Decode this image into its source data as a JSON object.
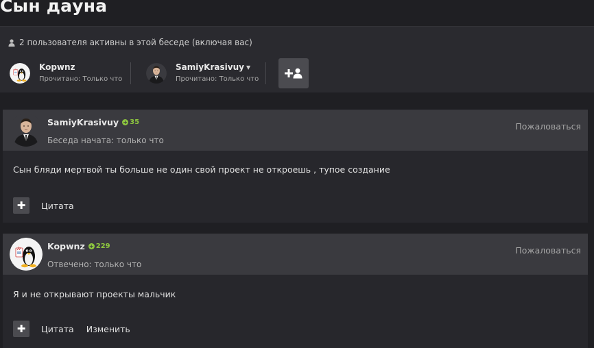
{
  "page": {
    "title": "Сын дауна"
  },
  "conversation": {
    "active_text": "2 пользователя активны в этой беседе (включая вас)",
    "participants": [
      {
        "name": "Kopwnz",
        "status": "Прочитано: Только что",
        "avatar": "tux-java-avatar"
      },
      {
        "name": "SamiyKrasivuy",
        "status": "Прочитано: Только что",
        "avatar": "suit-man-avatar",
        "has_dropdown": true
      }
    ],
    "add_participant_icon": "user-plus-icon"
  },
  "messages": [
    {
      "author": "SamiyKrasivuy",
      "reputation": "35",
      "meta": "Беседа начата: только что",
      "report_label": "Пожаловаться",
      "body": "Сын бляди мертвой ты больше не один свой проект не откроешь , тупое создание",
      "actions": [
        "Цитата"
      ],
      "avatar": "suit-man-avatar"
    },
    {
      "author": "Kopwnz",
      "reputation": "229",
      "meta": "Отвечено: только что",
      "report_label": "Пожаловаться",
      "body": "Я и не открывают проекты мальчик",
      "actions": [
        "Цитата",
        "Изменить"
      ],
      "avatar": "tux-java-avatar"
    }
  ],
  "colors": {
    "background": "#1f1f23",
    "panel": "#2a2a2f",
    "header": "#3a3a3f",
    "reputation": "#8dc63f",
    "button": "#4b4b50"
  }
}
